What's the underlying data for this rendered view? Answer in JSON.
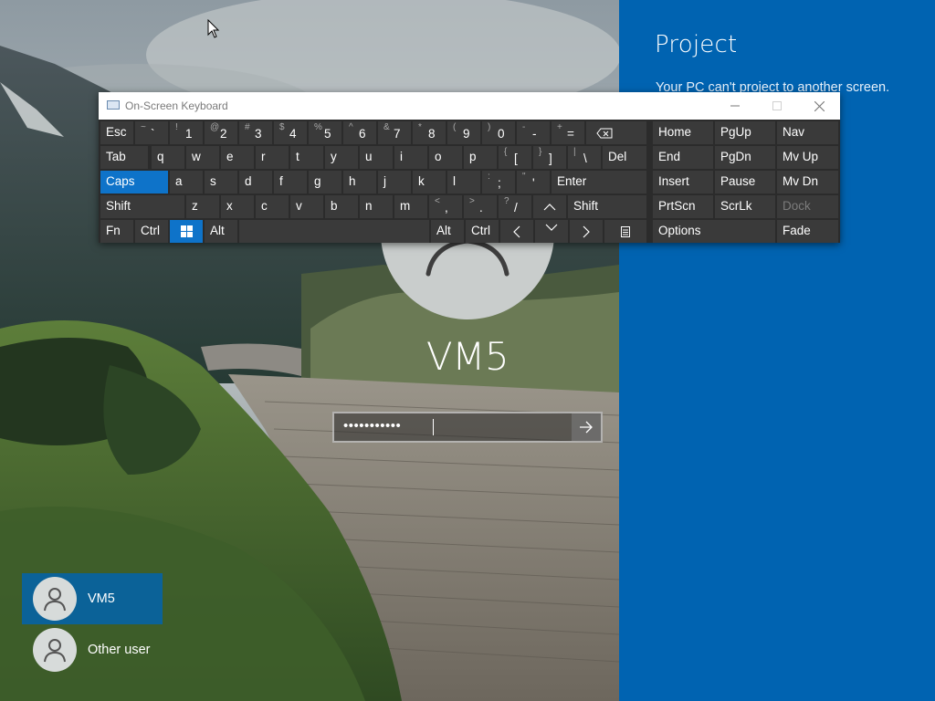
{
  "project": {
    "title": "Project",
    "message": "Your PC can't project to another screen. ... ng a"
  },
  "lock_screen": {
    "username": "VM5",
    "password_mask": "•••••••••••"
  },
  "users": [
    {
      "name": "VM5",
      "selected": true
    },
    {
      "name": "Other user",
      "selected": false
    }
  ],
  "osk": {
    "title": "On-Screen Keyboard",
    "keys": {
      "esc": "Esc",
      "tilde": {
        "sym": "~",
        "main": "`"
      },
      "n1": {
        "sym": "!",
        "main": "1"
      },
      "n2": {
        "sym": "@",
        "main": "2"
      },
      "n3": {
        "sym": "#",
        "main": "3"
      },
      "n4": {
        "sym": "$",
        "main": "4"
      },
      "n5": {
        "sym": "%",
        "main": "5"
      },
      "n6": {
        "sym": "^",
        "main": "6"
      },
      "n7": {
        "sym": "&",
        "main": "7"
      },
      "n8": {
        "sym": "*",
        "main": "8"
      },
      "n9": {
        "sym": "(",
        "main": "9"
      },
      "n0": {
        "sym": ")",
        "main": "0"
      },
      "minus": {
        "sym": "-",
        "main": "-"
      },
      "plus": {
        "sym": "+",
        "main": "="
      },
      "tab": "Tab",
      "q": "q",
      "w": "w",
      "e": "e",
      "r": "r",
      "t": "t",
      "y": "y",
      "u": "u",
      "i": "i",
      "o": "o",
      "p": "p",
      "lbracket": {
        "sym": "{",
        "main": "["
      },
      "rbracket": {
        "sym": "}",
        "main": "]"
      },
      "backslash": {
        "sym": "|",
        "main": "\\"
      },
      "del": "Del",
      "caps": "Caps",
      "a": "a",
      "s": "s",
      "d": "d",
      "f": "f",
      "g": "g",
      "h": "h",
      "j": "j",
      "k": "k",
      "l": "l",
      "semicolon": {
        "sym": ":",
        "main": ";"
      },
      "quote": {
        "sym": "\"",
        "main": "'"
      },
      "enter": "Enter",
      "shift_left": "Shift",
      "z": "z",
      "x": "x",
      "c": "c",
      "v": "v",
      "b": "b",
      "n": "n",
      "m": "m",
      "comma": {
        "sym": "<",
        "main": ","
      },
      "period": {
        "sym": ">",
        "main": "."
      },
      "slash": {
        "sym": "?",
        "main": "/"
      },
      "shift_right": "Shift",
      "fn": "Fn",
      "ctrl_left": "Ctrl",
      "alt_left": "Alt",
      "alt_right": "Alt",
      "ctrl_right": "Ctrl",
      "home": "Home",
      "pgup": "PgUp",
      "nav": "Nav",
      "end": "End",
      "pgdn": "PgDn",
      "mvup": "Mv Up",
      "insert": "Insert",
      "pause": "Pause",
      "mvdn": "Mv Dn",
      "prtscn": "PrtScn",
      "scrlk": "ScrLk",
      "dock": "Dock",
      "options": "Options",
      "fade": "Fade"
    },
    "active_keys": [
      "Caps"
    ],
    "disabled_keys": [
      "Dock"
    ]
  },
  "colors": {
    "accent": "#0063b1",
    "key_active": "#0e73c9",
    "key_bg": "#3a3a3a",
    "keyboard_bg": "#2b2b2b"
  }
}
